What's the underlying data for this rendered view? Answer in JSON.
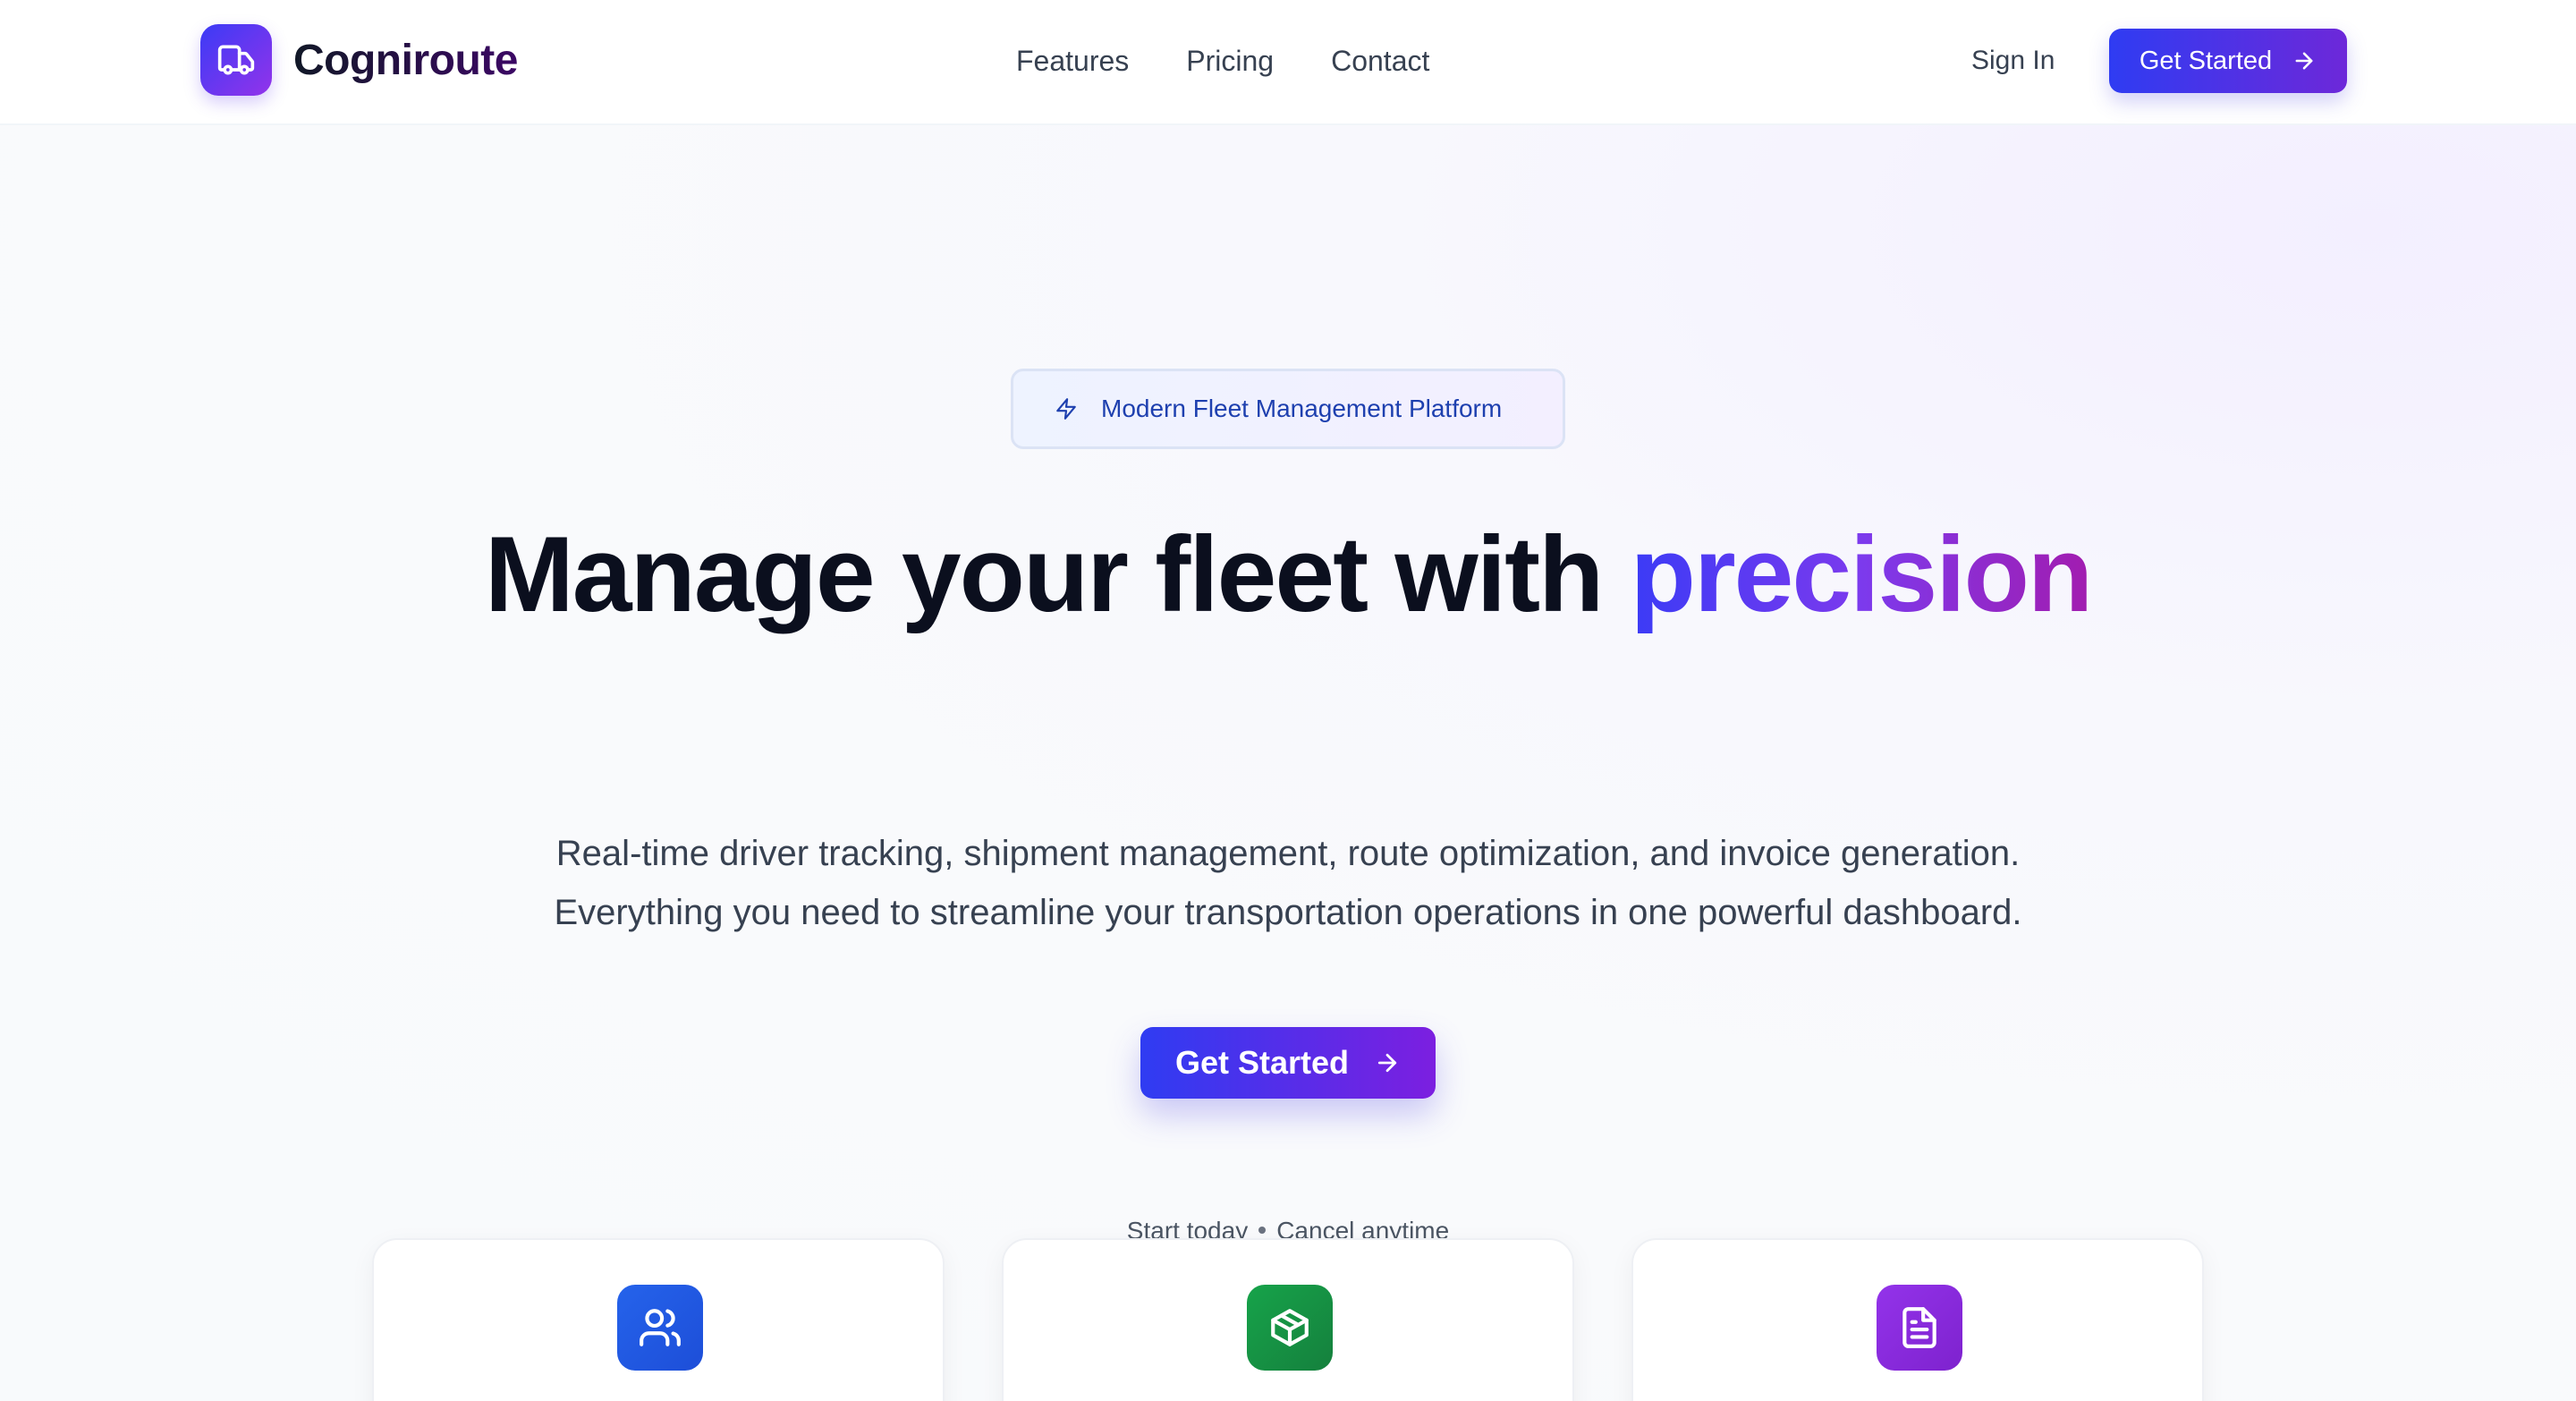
{
  "brand": {
    "name": "Cogniroute",
    "logo_icon": "truck-icon"
  },
  "nav": {
    "links": [
      "Features",
      "Pricing",
      "Contact"
    ],
    "sign_in": "Sign In",
    "cta": "Get Started"
  },
  "hero": {
    "badge": "Modern Fleet Management Platform",
    "badge_icon": "lightning-icon",
    "headline_main": "Manage your fleet with ",
    "headline_accent": "precision",
    "subtitle_line1": "Real-time driver tracking, shipment management, route optimization, and invoice generation.",
    "subtitle_line2": "Everything you need to streamline your transportation operations in one powerful dashboard.",
    "cta": "Get Started",
    "note_left": "Start today",
    "note_right": "Cancel anytime"
  },
  "features": [
    {
      "icon": "users-icon",
      "color": "#2563eb"
    },
    {
      "icon": "package-icon",
      "color": "#16a34a"
    },
    {
      "icon": "document-icon",
      "color": "#9333ea"
    }
  ],
  "colors": {
    "accent_start": "#2f3cf2",
    "accent_end": "#7c3aed",
    "text_dark": "#0b0f1e",
    "text_muted": "#374151"
  }
}
